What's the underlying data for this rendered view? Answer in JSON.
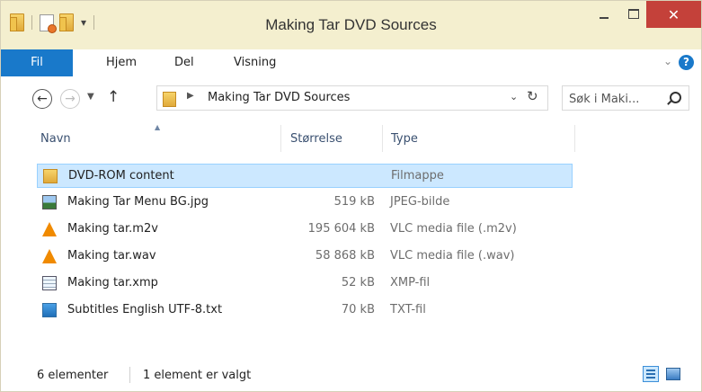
{
  "window": {
    "title": "Making Tar DVD Sources",
    "close_glyph": "✕"
  },
  "ribbon": {
    "tabs": [
      "Fil",
      "Hjem",
      "Del",
      "Visning"
    ],
    "help": "?"
  },
  "navigation": {
    "path": "Making Tar DVD Sources",
    "search_placeholder": "Søk i Maki..."
  },
  "list": {
    "columns": [
      "Navn",
      "Størrelse",
      "Type"
    ],
    "rows": [
      {
        "name": "DVD-ROM content",
        "size": "",
        "type": "Filmappe",
        "icon": "folder-icon",
        "selected": true
      },
      {
        "name": "Making Tar Menu BG.jpg",
        "size": "519 kB",
        "type": "JPEG-bilde",
        "icon": "image-icon"
      },
      {
        "name": "Making tar.m2v",
        "size": "195 604 kB",
        "type": "VLC media file (.m2v)",
        "icon": "vlc-icon"
      },
      {
        "name": "Making tar.wav",
        "size": "58 868 kB",
        "type": "VLC media file (.wav)",
        "icon": "vlc-icon"
      },
      {
        "name": "Making tar.xmp",
        "size": "52 kB",
        "type": "XMP-fil",
        "icon": "xmp-file-icon"
      },
      {
        "name": "Subtitles English UTF-8.txt",
        "size": "70 kB",
        "type": "TXT-fil",
        "icon": "text-file-icon"
      }
    ]
  },
  "status": {
    "count": "6 elementer",
    "selection": "1 element er valgt"
  },
  "colors": {
    "accent": "#1979ca",
    "titlebar": "#f4efcf",
    "close": "#c4413a",
    "selection": "#cce8ff"
  }
}
